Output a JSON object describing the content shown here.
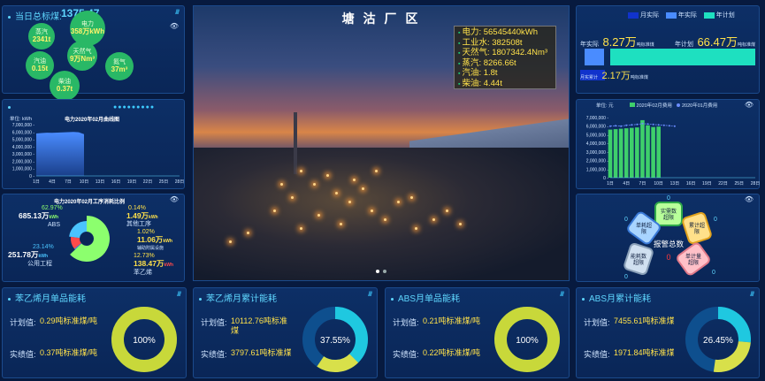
{
  "total_power": {
    "label": "当日总标煤:",
    "value": "1375.47"
  },
  "bubbles": [
    {
      "name": "蒸汽",
      "value": "2341t"
    },
    {
      "name": "电力",
      "value": "358万kWh"
    },
    {
      "name": "天然气",
      "value": "9万Nm³"
    },
    {
      "name": "汽油",
      "value": "0.15t"
    },
    {
      "name": "氮气",
      "value": "37m³"
    },
    {
      "name": "柴油",
      "value": "0.37t"
    }
  ],
  "power_curve": {
    "unit": "单位:  kWh",
    "title": "电力2020年02月曲线图",
    "yticks": [
      "7,000,000 -",
      "6,000,000 -",
      "5,000,000 -",
      "4,000,000 -",
      "3,000,000 -",
      "2,000,000 -",
      "1,000,000 -",
      "0 -"
    ],
    "xticks": [
      "1日",
      "4日",
      "7日",
      "10日",
      "13日",
      "16日",
      "19日",
      "22日",
      "25日",
      "28日"
    ]
  },
  "pie": {
    "title": "电力2020年02月工序消耗比例",
    "items": [
      {
        "pct": "62.97%",
        "value": "685.13万",
        "unit": "kWh",
        "name": "ABS"
      },
      {
        "pct": "0.14%",
        "value": "1.49万",
        "unit": "kWh",
        "name": "其他工序"
      },
      {
        "pct": "1.02%",
        "value": "11.06万",
        "unit": "kWh",
        "name": "辅助附属设施"
      },
      {
        "pct": "12.73%",
        "value": "138.47万",
        "unit": "kWh",
        "name": "苯乙烯"
      },
      {
        "pct": "23.14%",
        "value": "251.78万",
        "unit": "kWh",
        "name": "公用工程"
      }
    ],
    "chart_data": {
      "type": "pie",
      "title": "电力2020年02月工序消耗比例",
      "labels": [
        "ABS",
        "其他工序",
        "辅助附属设施",
        "苯乙烯",
        "公用工程"
      ],
      "values": [
        62.97,
        0.14,
        1.02,
        12.73,
        23.14
      ],
      "colors": [
        "#8cff6e",
        "#ff6a4a",
        "#3a8eff",
        "#ff4a4a",
        "#4ac4ff"
      ]
    }
  },
  "scene": {
    "title": "塘 沽 厂 区",
    "info": [
      {
        "label": "电力:",
        "value": "56545440kWh"
      },
      {
        "label": "工业水:",
        "value": "382508t"
      },
      {
        "label": "天然气:",
        "value": "1807342.4Nm³"
      },
      {
        "label": "蒸汽:",
        "value": "8266.66t"
      },
      {
        "label": "汽油:",
        "value": "1.8t"
      },
      {
        "label": "柴油:",
        "value": "4.44t"
      }
    ]
  },
  "plan": {
    "legend": [
      "月实际",
      "年实际",
      "年计划"
    ],
    "legend_colors": [
      "#1133cc",
      "#4a8cff",
      "#1ee0c0"
    ],
    "year_actual_label": "年实际",
    "year_actual_value": "8.27万",
    "year_actual_unit": "吨标准煤",
    "year_plan_label": "年计划",
    "year_plan_value": "66.47万",
    "year_plan_unit": "吨标准煤",
    "month_label": "月实累计",
    "month_value": "2.17万",
    "month_unit": "吨标准煤"
  },
  "compare": {
    "unit": "单位:  元",
    "legend": [
      "2020年02月费用",
      "2020年01月费用"
    ],
    "yticks": [
      "7,000,000 -",
      "6,000,000 -",
      "5,000,000 -",
      "4,000,000 -",
      "3,000,000 -",
      "2,000,000 -",
      "1,000,000 -",
      "0 -"
    ],
    "xticks": [
      "1日",
      "4日",
      "7日",
      "10日",
      "13日",
      "16日",
      "19日",
      "22日",
      "25日",
      "28日"
    ]
  },
  "alarm": {
    "title": "报警总数",
    "total": "0",
    "items": [
      {
        "name": "实需数",
        "sub": "超限",
        "count": "0"
      },
      {
        "name": "单耗超",
        "sub": "限",
        "count": "0"
      },
      {
        "name": "累计超",
        "sub": "限",
        "count": "0"
      },
      {
        "name": "单计量",
        "sub": "超限",
        "count": "0"
      },
      {
        "name": "能耗数",
        "sub": "超限",
        "count": "0"
      },
      {
        "name": "超标率",
        "sub": "超限",
        "count": "0"
      }
    ]
  },
  "bottom": [
    {
      "title": "苯乙烯月单品能耗",
      "l1": "计划值:",
      "v1": "0.29吨标准煤/吨",
      "l2": "实绩值:",
      "v2": "0.37吨标准煤/吨",
      "pct": "100%",
      "ratio": 1.0
    },
    {
      "title": "苯乙烯月累计能耗",
      "l1": "计划值:",
      "v1": "10112.76吨标准煤",
      "l2": "实绩值:",
      "v2": "3797.61吨标准煤",
      "pct": "37.55%",
      "ratio": 0.3755
    },
    {
      "title": "ABS月单品能耗",
      "l1": "计划值:",
      "v1": "0.21吨标准煤/吨",
      "l2": "实绩值:",
      "v2": "0.22吨标准煤/吨",
      "pct": "100%",
      "ratio": 1.0
    },
    {
      "title": "ABS月累计能耗",
      "l1": "计划值:",
      "v1": "7455.61吨标准煤",
      "l2": "实绩值:",
      "v2": "1971.84吨标准煤",
      "pct": "26.45%",
      "ratio": 0.2645
    }
  ],
  "chart_data": [
    {
      "type": "area",
      "title": "电力2020年02月曲线图",
      "ylabel": "单位:  kWh",
      "ylim": [
        0,
        7000000
      ],
      "x": [
        "1日",
        "2日",
        "3日",
        "4日",
        "5日",
        "6日",
        "7日",
        "8日",
        "9日",
        "10日",
        "11日",
        "12日",
        "13日",
        "14日",
        "15日",
        "16日",
        "17日",
        "18日",
        "19日",
        "20日",
        "21日",
        "22日",
        "23日",
        "24日",
        "25日",
        "26日",
        "27日",
        "28日"
      ],
      "values": [
        5800000,
        5850000,
        5900000,
        5880000,
        5920000,
        5950000,
        5980000,
        6000000,
        5960000,
        5700000
      ]
    },
    {
      "type": "bar",
      "ylabel": "单位:  元",
      "ylim": [
        0,
        7000000
      ],
      "series": [
        {
          "name": "2020年02月费用",
          "values": [
            5600000,
            5650000,
            5700000,
            5750000,
            5800000,
            5850000,
            6700000,
            6100000,
            5900000,
            5950000
          ]
        },
        {
          "name": "2020年01月费用",
          "values": [
            6000000,
            6050000,
            6000000,
            6100000,
            6150000,
            6200000,
            6300000,
            6250000,
            6200000,
            6150000,
            6100000,
            6050000,
            6000000
          ]
        }
      ],
      "x": [
        "1日",
        "2日",
        "3日",
        "4日",
        "5日",
        "6日",
        "7日",
        "8日",
        "9日",
        "10日",
        "11日",
        "12日",
        "13日"
      ]
    }
  ]
}
